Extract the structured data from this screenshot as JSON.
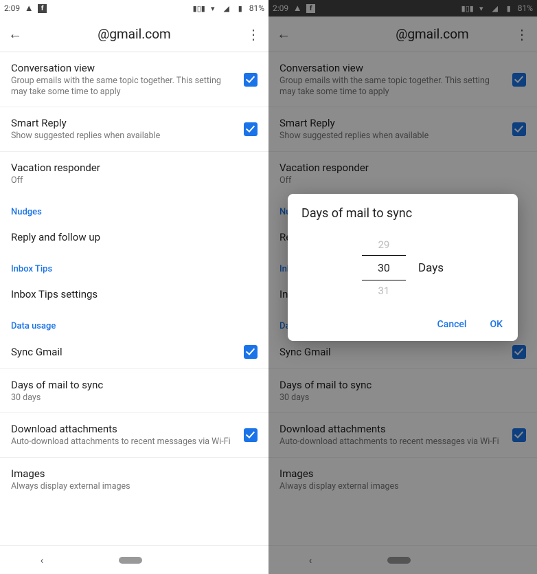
{
  "statusbar": {
    "time": "2:09",
    "battery": "81%"
  },
  "header": {
    "title_left": "@gmail.com",
    "title_right": "@gmail.com"
  },
  "settings": {
    "conversation": {
      "title": "Conversation view",
      "sub": "Group emails with the same topic together. This setting may take some time to apply"
    },
    "smartreply": {
      "title": "Smart Reply",
      "sub": "Show suggested replies when available"
    },
    "vacation": {
      "title": "Vacation responder",
      "sub": "Off"
    },
    "nudges_hdr": "Nudges",
    "reply_follow": "Reply and follow up",
    "inboxtips_hdr": "Inbox Tips",
    "inboxtips_item": "Inbox Tips settings",
    "datausage_hdr": "Data usage",
    "sync_gmail": "Sync Gmail",
    "days_sync": {
      "title": "Days of mail to sync",
      "sub": "30 days"
    },
    "download": {
      "title": "Download attachments",
      "sub": "Auto-download attachments to recent messages via Wi-Fi"
    },
    "images": {
      "title": "Images",
      "sub": "Always display external images"
    }
  },
  "dialog": {
    "title": "Days of mail to sync",
    "prev": "29",
    "sel": "30",
    "next": "31",
    "unit": "Days",
    "cancel": "Cancel",
    "ok": "OK"
  }
}
